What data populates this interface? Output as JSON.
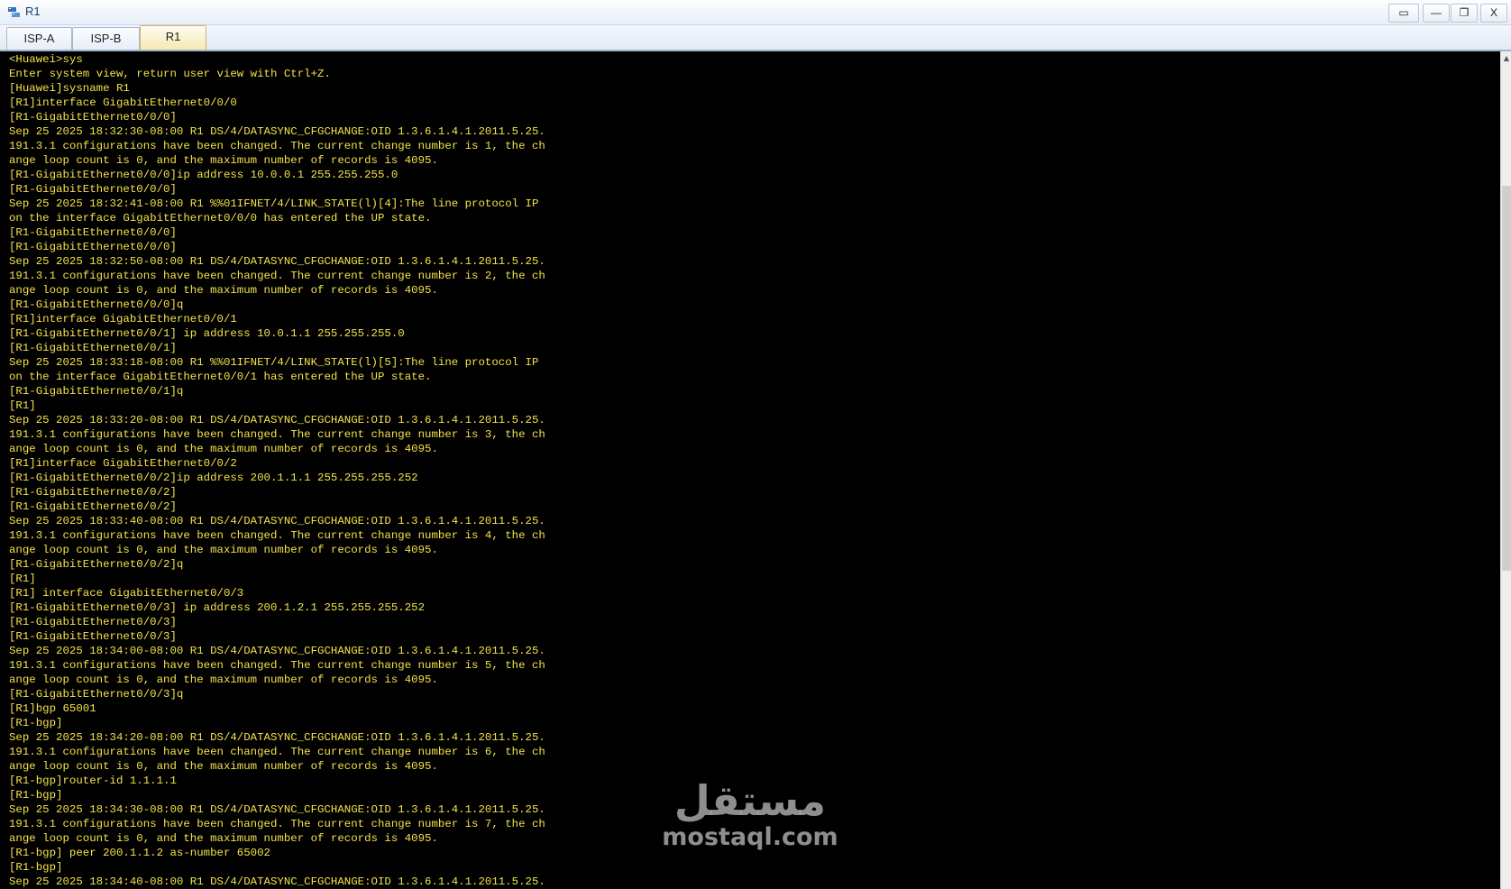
{
  "window": {
    "title": "R1",
    "buttons": {
      "restore_small": "▭",
      "minimize": "—",
      "maximize": "❐",
      "close": "X"
    },
    "icon": "network-device-icon"
  },
  "tabs": [
    {
      "label": "ISP-A",
      "active": false
    },
    {
      "label": "ISP-B",
      "active": false
    },
    {
      "label": "R1",
      "active": true
    }
  ],
  "terminal": {
    "text_color": "#f2e24a",
    "background": "#000000",
    "lines": [
      "<Huawei>sys",
      "Enter system view, return user view with Ctrl+Z.",
      "[Huawei]sysname R1",
      "[R1]interface GigabitEthernet0/0/0",
      "[R1-GigabitEthernet0/0/0]",
      "Sep 25 2025 18:32:30-08:00 R1 DS/4/DATASYNC_CFGCHANGE:OID 1.3.6.1.4.1.2011.5.25.",
      "191.3.1 configurations have been changed. The current change number is 1, the ch",
      "ange loop count is 0, and the maximum number of records is 4095.",
      "[R1-GigabitEthernet0/0/0]ip address 10.0.0.1 255.255.255.0",
      "[R1-GigabitEthernet0/0/0]",
      "Sep 25 2025 18:32:41-08:00 R1 %%01IFNET/4/LINK_STATE(l)[4]:The line protocol IP",
      "on the interface GigabitEthernet0/0/0 has entered the UP state.",
      "[R1-GigabitEthernet0/0/0]",
      "[R1-GigabitEthernet0/0/0]",
      "Sep 25 2025 18:32:50-08:00 R1 DS/4/DATASYNC_CFGCHANGE:OID 1.3.6.1.4.1.2011.5.25.",
      "191.3.1 configurations have been changed. The current change number is 2, the ch",
      "ange loop count is 0, and the maximum number of records is 4095.",
      "[R1-GigabitEthernet0/0/0]q",
      "[R1]interface GigabitEthernet0/0/1",
      "[R1-GigabitEthernet0/0/1] ip address 10.0.1.1 255.255.255.0",
      "[R1-GigabitEthernet0/0/1]",
      "Sep 25 2025 18:33:18-08:00 R1 %%01IFNET/4/LINK_STATE(l)[5]:The line protocol IP",
      "on the interface GigabitEthernet0/0/1 has entered the UP state.",
      "[R1-GigabitEthernet0/0/1]q",
      "[R1]",
      "Sep 25 2025 18:33:20-08:00 R1 DS/4/DATASYNC_CFGCHANGE:OID 1.3.6.1.4.1.2011.5.25.",
      "191.3.1 configurations have been changed. The current change number is 3, the ch",
      "ange loop count is 0, and the maximum number of records is 4095.",
      "[R1]interface GigabitEthernet0/0/2",
      "[R1-GigabitEthernet0/0/2]ip address 200.1.1.1 255.255.255.252",
      "[R1-GigabitEthernet0/0/2]",
      "[R1-GigabitEthernet0/0/2]",
      "Sep 25 2025 18:33:40-08:00 R1 DS/4/DATASYNC_CFGCHANGE:OID 1.3.6.1.4.1.2011.5.25.",
      "191.3.1 configurations have been changed. The current change number is 4, the ch",
      "ange loop count is 0, and the maximum number of records is 4095.",
      "[R1-GigabitEthernet0/0/2]q",
      "[R1]",
      "[R1] interface GigabitEthernet0/0/3",
      "[R1-GigabitEthernet0/0/3] ip address 200.1.2.1 255.255.255.252",
      "[R1-GigabitEthernet0/0/3]",
      "[R1-GigabitEthernet0/0/3]",
      "Sep 25 2025 18:34:00-08:00 R1 DS/4/DATASYNC_CFGCHANGE:OID 1.3.6.1.4.1.2011.5.25.",
      "191.3.1 configurations have been changed. The current change number is 5, the ch",
      "ange loop count is 0, and the maximum number of records is 4095.",
      "[R1-GigabitEthernet0/0/3]q",
      "[R1]bgp 65001",
      "[R1-bgp]",
      "Sep 25 2025 18:34:20-08:00 R1 DS/4/DATASYNC_CFGCHANGE:OID 1.3.6.1.4.1.2011.5.25.",
      "191.3.1 configurations have been changed. The current change number is 6, the ch",
      "ange loop count is 0, and the maximum number of records is 4095.",
      "[R1-bgp]router-id 1.1.1.1",
      "[R1-bgp]",
      "Sep 25 2025 18:34:30-08:00 R1 DS/4/DATASYNC_CFGCHANGE:OID 1.3.6.1.4.1.2011.5.25.",
      "191.3.1 configurations have been changed. The current change number is 7, the ch",
      "ange loop count is 0, and the maximum number of records is 4095.",
      "[R1-bgp] peer 200.1.1.2 as-number 65002",
      "[R1-bgp]",
      "Sep 25 2025 18:34:40-08:00 R1 DS/4/DATASYNC_CFGCHANGE:OID 1.3.6.1.4.1.2011.5.25."
    ]
  },
  "scrollbar": {
    "position_fraction": 0.16,
    "visible_fraction": 0.46
  },
  "watermark": {
    "arabic": "مستقل",
    "latin": "mostaql.com"
  }
}
